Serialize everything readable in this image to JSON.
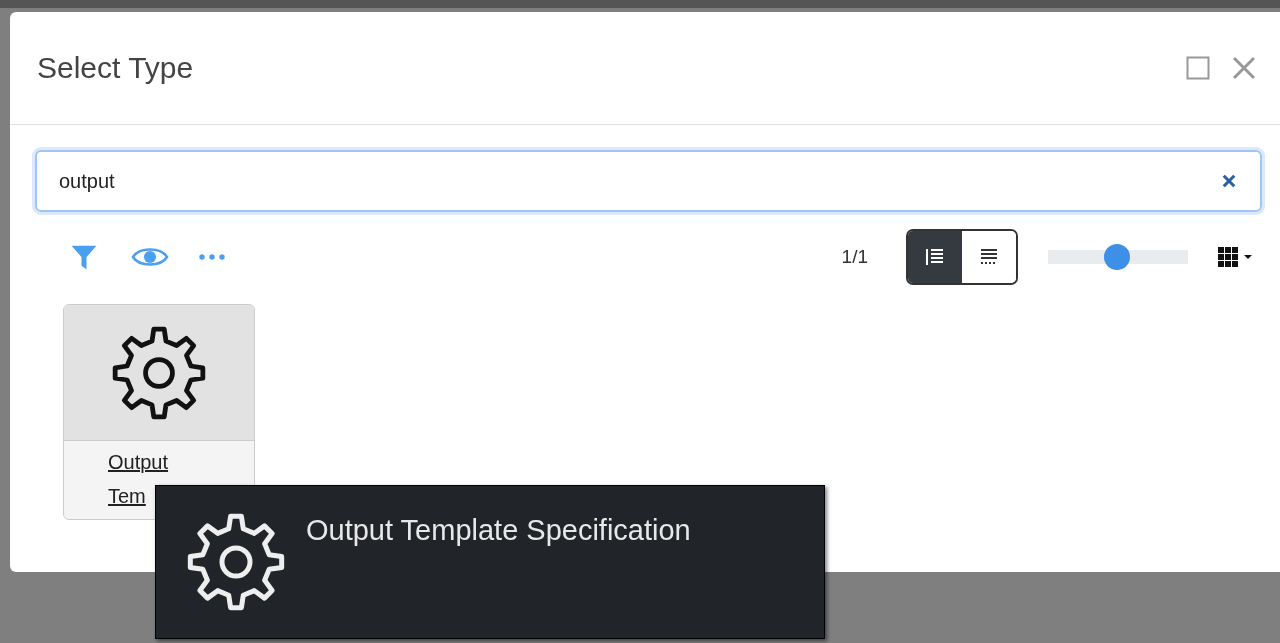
{
  "dialog": {
    "title": "Select Type",
    "search": {
      "value": "output"
    },
    "toolbar": {
      "page": "1/1",
      "view_modes": [
        {
          "selected": true
        },
        {
          "selected": false
        }
      ],
      "size_slider": {
        "level": 0.49
      }
    },
    "cards": [
      {
        "label": "Output Tem"
      }
    ]
  },
  "tooltip": {
    "title": "Output Template Specification"
  }
}
